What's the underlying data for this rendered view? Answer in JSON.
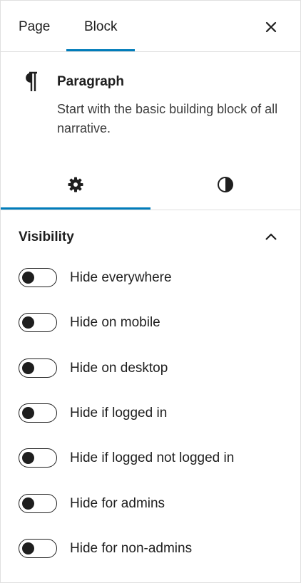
{
  "tabs": {
    "page_label": "Page",
    "block_label": "Block",
    "active": "Block"
  },
  "block": {
    "title": "Paragraph",
    "description": "Start with the basic building block of all narrative."
  },
  "sub_tabs": {
    "active": "settings"
  },
  "visibility": {
    "title": "Visibility",
    "expanded": true,
    "toggles": [
      {
        "label": "Hide everywhere",
        "checked": false
      },
      {
        "label": "Hide on mobile",
        "checked": false
      },
      {
        "label": "Hide on desktop",
        "checked": false
      },
      {
        "label": "Hide if logged in",
        "checked": false
      },
      {
        "label": "Hide if logged not logged in",
        "checked": false
      },
      {
        "label": "Hide for admins",
        "checked": false
      },
      {
        "label": "Hide for non-admins",
        "checked": false
      }
    ]
  },
  "colors": {
    "accent": "#007cba",
    "text": "#1e1e1e",
    "border": "#e0e0e0"
  }
}
